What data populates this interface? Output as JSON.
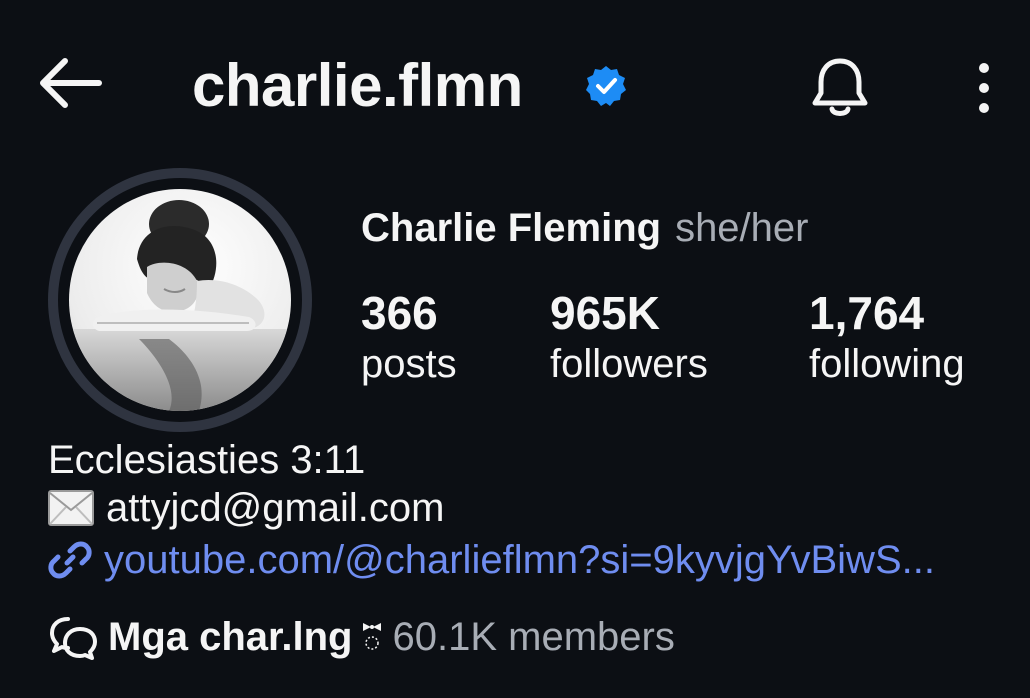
{
  "header": {
    "username": "charlie.flmn",
    "icons": {
      "back": "back-arrow-icon",
      "verified": "verified-badge-icon",
      "notifications": "bell-icon",
      "more": "more-vertical-icon"
    }
  },
  "profile": {
    "full_name": "Charlie Fleming",
    "pronouns": "she/her",
    "stats": [
      {
        "value": "366",
        "label": "posts"
      },
      {
        "value": "965K",
        "label": "followers"
      },
      {
        "value": "1,764",
        "label": "following"
      }
    ],
    "bio": {
      "line1": "Ecclesiasties 3:11",
      "email": "attyjcd@gmail.com",
      "link": "youtube.com/@charlieflmn?si=9kyvjgYvBiwS..."
    }
  },
  "community": {
    "name": "Mga char.lng",
    "members": "60.1K members"
  },
  "colors": {
    "background": "#0c0f14",
    "text": "#f5f5f5",
    "muted": "#a8adb5",
    "link": "#6f8df0",
    "verified": "#1d8cf5",
    "avatar_ring": "#2f3440"
  }
}
